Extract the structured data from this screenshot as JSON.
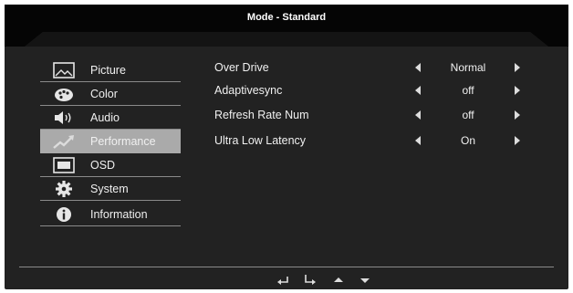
{
  "header": {
    "title": "Mode - Standard"
  },
  "menu": {
    "items": [
      {
        "label": "Picture",
        "icon": "picture-icon"
      },
      {
        "label": "Color",
        "icon": "palette-icon"
      },
      {
        "label": "Audio",
        "icon": "speaker-icon"
      },
      {
        "label": "Performance",
        "icon": "performance-icon",
        "selected": true
      },
      {
        "label": "OSD",
        "icon": "osd-icon"
      },
      {
        "label": "System",
        "icon": "gear-icon"
      },
      {
        "label": "Information",
        "icon": "info-icon"
      }
    ]
  },
  "settings": [
    {
      "name": "Over Drive",
      "value": "Normal"
    },
    {
      "name": "Adaptivesync",
      "value": "off"
    },
    {
      "name": "Refresh Rate Num",
      "value": "off"
    },
    {
      "name": "Ultra Low Latency",
      "value": "On"
    }
  ],
  "footer": {
    "icons": [
      "back-icon",
      "enter-icon",
      "up-icon",
      "down-icon"
    ]
  },
  "colors": {
    "background": "#222222",
    "selected": "#aaaaaa",
    "text": "#f0f0f0"
  }
}
